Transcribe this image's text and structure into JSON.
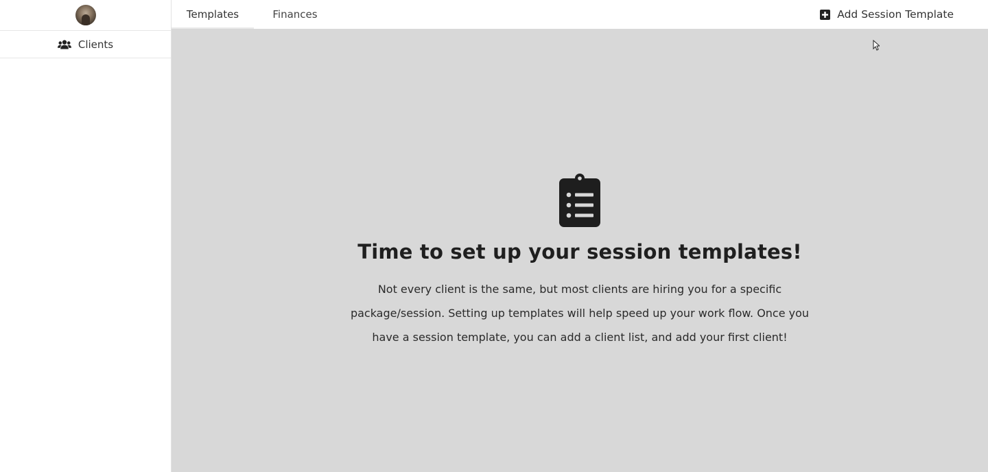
{
  "sidebar": {
    "avatar_alt": "",
    "items": [
      {
        "label": "Clients",
        "icon": "users-icon"
      }
    ]
  },
  "header": {
    "tabs": [
      {
        "label": "Templates",
        "active": true
      },
      {
        "label": "Finances",
        "active": false
      }
    ],
    "add_button_label": "Add Session Template",
    "add_button_icon": "plus-square-icon"
  },
  "empty_state": {
    "icon": "clipboard-list-icon",
    "title": "Time to set up your session templates!",
    "body": "Not every client is the same, but most clients are hiring you for a specific package/session. Setting up templates will help speed up your work flow. Once you have a session template, you can add a client list, and add your first client!"
  },
  "colors": {
    "main_background": "#d8d8d8",
    "icon_dark": "#1e1e1e"
  }
}
